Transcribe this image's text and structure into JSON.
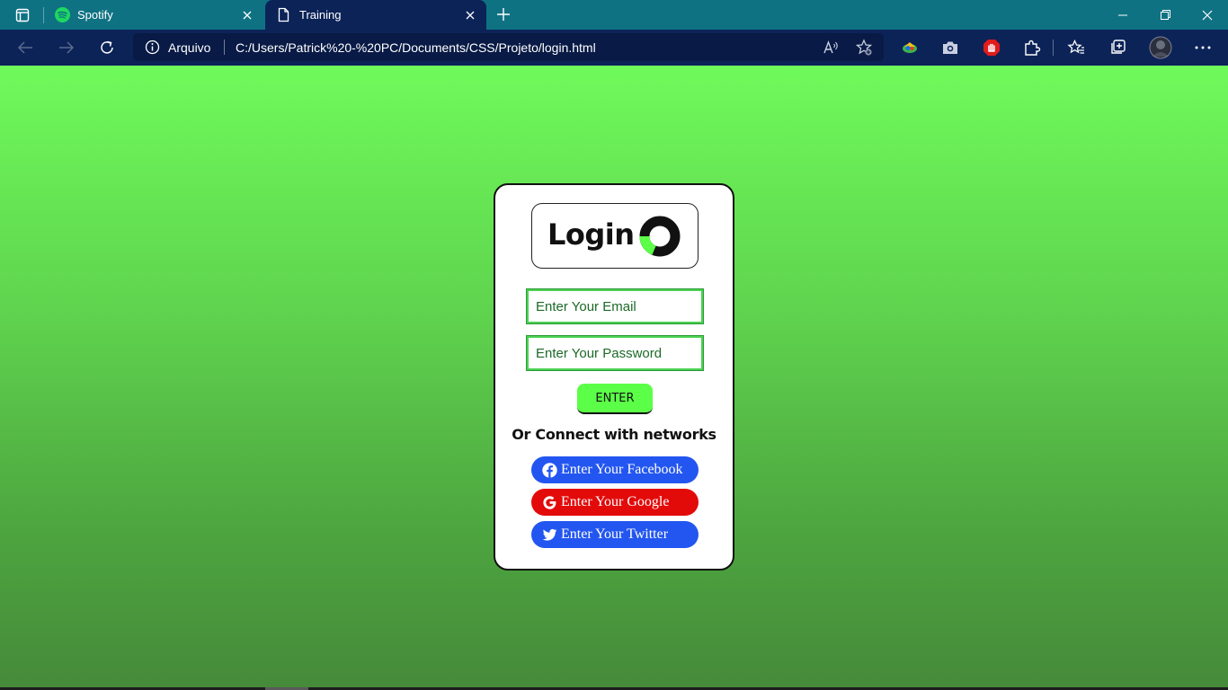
{
  "tabs": [
    {
      "title": "Spotify",
      "icon": "spotify-icon",
      "active": false
    },
    {
      "title": "Training",
      "icon": "page-icon",
      "active": true
    }
  ],
  "address_bar": {
    "security_label": "Arquivo",
    "url": "C:/Users/Patrick%20-%20PC/Documents/CSS/Projeto/login.html"
  },
  "colors": {
    "tabbar": "#0f7283",
    "toolbar": "#0c2358",
    "page_top": "#6ffa5b",
    "page_bottom": "#468a3a",
    "enter_button": "#5bff47",
    "facebook": "#2356f0",
    "google": "#e30a0a",
    "twitter": "#2356f0"
  },
  "login": {
    "title": "Login",
    "email_placeholder": "Enter Your Email",
    "password_placeholder": "Enter Your Password",
    "enter_label": "ENTER",
    "connect_title": "Or Connect with networks",
    "social": [
      {
        "label": "Enter Your Facebook",
        "icon": "facebook-icon"
      },
      {
        "label": "Enter Your Google",
        "icon": "google-icon"
      },
      {
        "label": "Enter Your Twitter",
        "icon": "twitter-icon"
      }
    ]
  }
}
